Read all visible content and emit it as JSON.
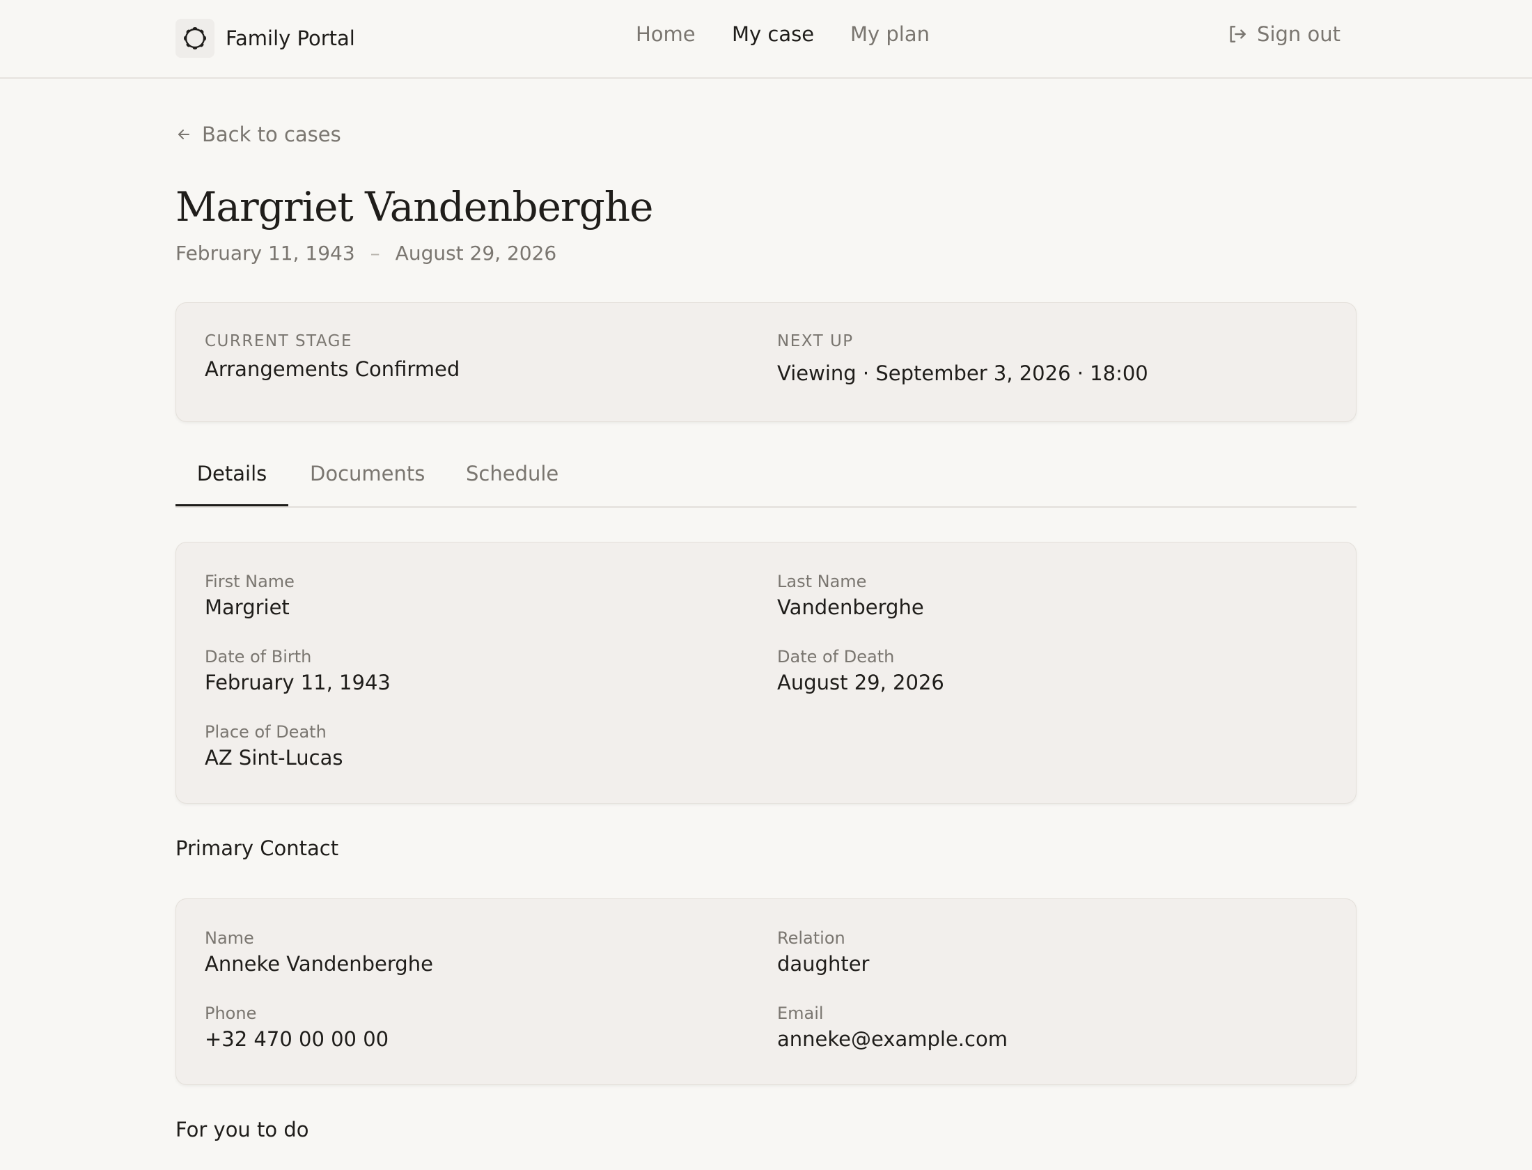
{
  "app": {
    "name": "Family Portal"
  },
  "nav": {
    "home": "Home",
    "my_case": "My case",
    "my_plan": "My plan",
    "sign_out": "Sign out",
    "active": "My case"
  },
  "back_link": "Back to cases",
  "person": {
    "full_name": "Margriet Vandenberghe",
    "born": "February 11, 1943",
    "dash": "–",
    "died": "August 29, 2026"
  },
  "status": {
    "current_stage_label": "CURRENT STAGE",
    "current_stage_value": "Arrangements Confirmed",
    "next_up_label": "NEXT UP",
    "next_up_value": "Viewing · September 3, 2026 · 18:00"
  },
  "tabs": [
    {
      "label": "Details",
      "active": true
    },
    {
      "label": "Documents",
      "active": false
    },
    {
      "label": "Schedule",
      "active": false
    }
  ],
  "details": {
    "first_name_label": "First Name",
    "first_name": "Margriet",
    "last_name_label": "Last Name",
    "last_name": "Vandenberghe",
    "dob_label": "Date of Birth",
    "dob": "February 11, 1943",
    "dod_label": "Date of Death",
    "dod": "August 29, 2026",
    "place_label": "Place of Death",
    "place": "AZ Sint-Lucas"
  },
  "primary_contact": {
    "heading": "Primary Contact",
    "name_label": "Name",
    "name": "Anneke Vandenberghe",
    "relation_label": "Relation",
    "relation": "daughter",
    "phone_label": "Phone",
    "phone": "+32 470 00 00 00",
    "email_label": "Email",
    "email": "anneke@example.com"
  },
  "todo": {
    "heading": "For you to do"
  },
  "icons": {
    "logo": "wreath-logo-icon",
    "sign_out": "sign-out-icon",
    "back": "arrow-left-icon"
  },
  "colors": {
    "background": "#f8f7f4",
    "card": "#f2efec",
    "text": "#1f1d1a",
    "muted": "#7a7670"
  }
}
